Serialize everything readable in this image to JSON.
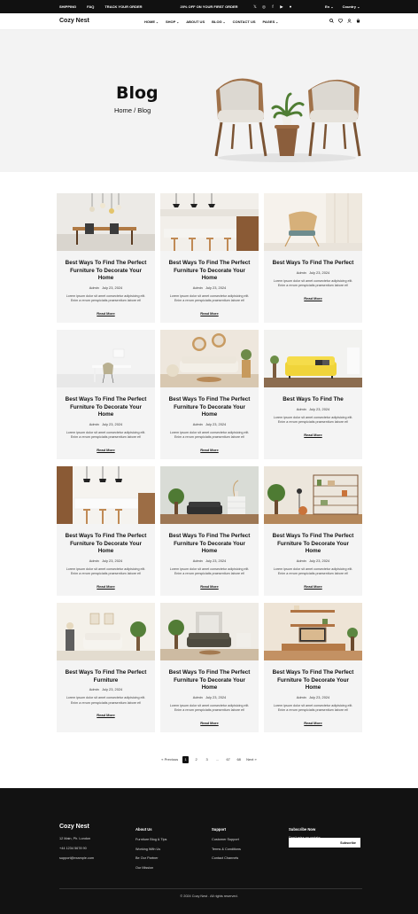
{
  "topbar": {
    "links": [
      "SHIPPING",
      "FAQ",
      "TRACK YOUR ORDER"
    ],
    "promo": "20% OFF ON YOUR FIRST ORDER",
    "language": "En",
    "country": "Country"
  },
  "header": {
    "logo": "Cozy Nest",
    "nav": [
      {
        "label": "HOME",
        "dropdown": true
      },
      {
        "label": "SHOP",
        "dropdown": true
      },
      {
        "label": "ABOUT US",
        "dropdown": false
      },
      {
        "label": "BLOG",
        "dropdown": true
      },
      {
        "label": "CONTACT US",
        "dropdown": false
      },
      {
        "label": "PAGES",
        "dropdown": true
      }
    ]
  },
  "hero": {
    "title": "Blog",
    "breadcrumb": "Home / Blog"
  },
  "posts": [
    {
      "title": "Best Ways To Find The Perfect Furniture To Decorate Your Home",
      "author": "Admin",
      "date": "July 23, 2024",
      "excerpt": "Lorem ipsum dolor sit amet consectetur adipisicing elit. Enim a rerum perspiciatis praesentium labore et!",
      "more": "Read More",
      "image": "dining-lamps"
    },
    {
      "title": "Best Ways To Find The Perfect Furniture To Decorate Your Home",
      "author": "Admin",
      "date": "July 23, 2024",
      "excerpt": "Lorem ipsum dolor sit amet consectetur adipisicing elit. Enim a rerum perspiciatis praesentium labore et!",
      "more": "Read More",
      "image": "kitchen-stools"
    },
    {
      "title": "Best Ways To Find The Perfect",
      "author": "Admin",
      "date": "July 23, 2024",
      "excerpt": "Lorem ipsum dolor sit amet consectetur adipisicing elit. Enim a rerum perspiciatis praesentium labore et!",
      "more": "Read More",
      "image": "lounge-chair"
    },
    {
      "title": "Best Ways To Find The Perfect Furniture To Decorate Your Home",
      "author": "Admin",
      "date": "July 23, 2024",
      "excerpt": "Lorem ipsum dolor sit amet consectetur adipisicing elit. Enim a rerum perspiciatis praesentium labore et!",
      "more": "Read More",
      "image": "white-desk"
    },
    {
      "title": "Best Ways To Find The Perfect Furniture To Decorate Your Home",
      "author": "Admin",
      "date": "July 23, 2024",
      "excerpt": "Lorem ipsum dolor sit amet consectetur adipisicing elit. Enim a rerum perspiciatis praesentium labore et!",
      "more": "Read More",
      "image": "mirrors-living"
    },
    {
      "title": "Best Ways To Find The",
      "author": "Admin",
      "date": "July 23, 2024",
      "excerpt": "Lorem ipsum dolor sit amet consectetur adipisicing elit. Enim a rerum perspiciatis praesentium labore et!",
      "more": "Read More",
      "image": "yellow-sofa"
    },
    {
      "title": "Best Ways To Find The Perfect Furniture To Decorate Your Home",
      "author": "Admin",
      "date": "July 23, 2024",
      "excerpt": "Lorem ipsum dolor sit amet consectetur adipisicing elit. Enim a rerum perspiciatis praesentium labore et!",
      "more": "Read More",
      "image": "kitchen-island"
    },
    {
      "title": "Best Ways To Find The Perfect Furniture To Decorate Your Home",
      "author": "Admin",
      "date": "July 23, 2024",
      "excerpt": "Lorem ipsum dolor sit amet consectetur adipisicing elit. Enim a rerum perspiciatis praesentium labore et!",
      "more": "Read More",
      "image": "plant-room"
    },
    {
      "title": "Best Ways To Find The Perfect Furniture To Decorate Your Home",
      "author": "Admin",
      "date": "July 23, 2024",
      "excerpt": "Lorem ipsum dolor sit amet consectetur adipisicing elit. Enim a rerum perspiciatis praesentium labore et!",
      "more": "Read More",
      "image": "shelves"
    },
    {
      "title": "Best Ways To Find The Perfect Furniture",
      "author": "Admin",
      "date": "July 23, 2024",
      "excerpt": "Lorem ipsum dolor sit amet consectetur adipisicing elit. Enim a rerum perspiciatis praesentium labore et!",
      "more": "Read More",
      "image": "bright-lounge"
    },
    {
      "title": "Best Ways To Find The Perfect Furniture To Decorate Your Home",
      "author": "Admin",
      "date": "July 23, 2024",
      "excerpt": "Lorem ipsum dolor sit amet consectetur adipisicing elit. Enim a rerum perspiciatis praesentium labore et!",
      "more": "Read More",
      "image": "dark-sofa"
    },
    {
      "title": "Best Ways To Find The Perfect Furniture To Decorate Your Home",
      "author": "Admin",
      "date": "July 23, 2024",
      "excerpt": "Lorem ipsum dolor sit amet consectetur adipisicing elit. Enim a rerum perspiciatis praesentium labore et!",
      "more": "Read More",
      "image": "tv-wall"
    }
  ],
  "pagination": {
    "previous": "« Previous",
    "pages": [
      "1",
      "2",
      "3",
      "...",
      "67",
      "68"
    ],
    "current": "1",
    "next": "Next »"
  },
  "footer": {
    "logo": "Cozy Nest",
    "contact": [
      "12 Main, Ph. London",
      "+44 1234 5678 90",
      "support@example.com"
    ],
    "about": {
      "heading": "About Us",
      "items": [
        "Furniture Blog & Tips",
        "Working With Us",
        "Be Our Partner",
        "Our Mission"
      ]
    },
    "support": {
      "heading": "Support",
      "items": [
        "Customer Support",
        "Terms & Conditions",
        "Contact Channels"
      ]
    },
    "subscribe": {
      "heading": "Subscribe Now",
      "subtext": "Don't miss an update",
      "button": "Subscribe"
    },
    "copyright": "© 2024 Cozy Nest . All rights reserved."
  },
  "colors": {
    "dark": "#121212",
    "card": "#f4f4f4",
    "hero": "#f3f3f3",
    "accent": "#111111"
  }
}
